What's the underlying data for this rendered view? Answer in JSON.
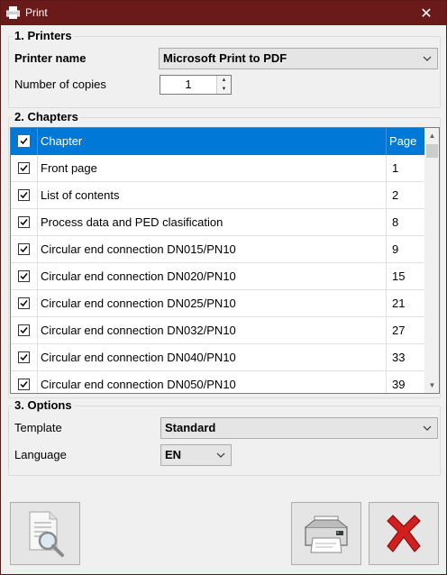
{
  "window": {
    "title": "Print",
    "close_glyph": "✕"
  },
  "printers": {
    "legend": "1. Printers",
    "printer_name_label": "Printer name",
    "printer_name_value": "Microsoft Print to PDF",
    "copies_label": "Number of copies",
    "copies_value": "1"
  },
  "chapters": {
    "legend": "2. Chapters",
    "header": {
      "chapter": "Chapter",
      "page": "Page",
      "checked": true
    },
    "rows": [
      {
        "chapter": "Front page",
        "page": "1",
        "checked": true
      },
      {
        "chapter": "List of contents",
        "page": "2",
        "checked": true
      },
      {
        "chapter": "Process data and PED clasification",
        "page": "8",
        "checked": true
      },
      {
        "chapter": "Circular end connection DN015/PN10",
        "page": "9",
        "checked": true
      },
      {
        "chapter": "Circular end connection DN020/PN10",
        "page": "15",
        "checked": true
      },
      {
        "chapter": "Circular end connection DN025/PN10",
        "page": "21",
        "checked": true
      },
      {
        "chapter": "Circular end connection DN032/PN10",
        "page": "27",
        "checked": true
      },
      {
        "chapter": "Circular end connection DN040/PN10",
        "page": "33",
        "checked": true
      },
      {
        "chapter": "Circular end connection DN050/PN10",
        "page": "39",
        "checked": true
      }
    ]
  },
  "options": {
    "legend": "3. Options",
    "template_label": "Template",
    "template_value": "Standard",
    "language_label": "Language",
    "language_value": "EN"
  },
  "buttons": {
    "preview_icon": "print-preview-icon",
    "print_icon": "printer-icon",
    "cancel_icon": "red-x-icon"
  },
  "colors": {
    "titlebar": "#6b1a1a",
    "selection": "#0078d7",
    "cancel_red": "#d21f1f"
  }
}
